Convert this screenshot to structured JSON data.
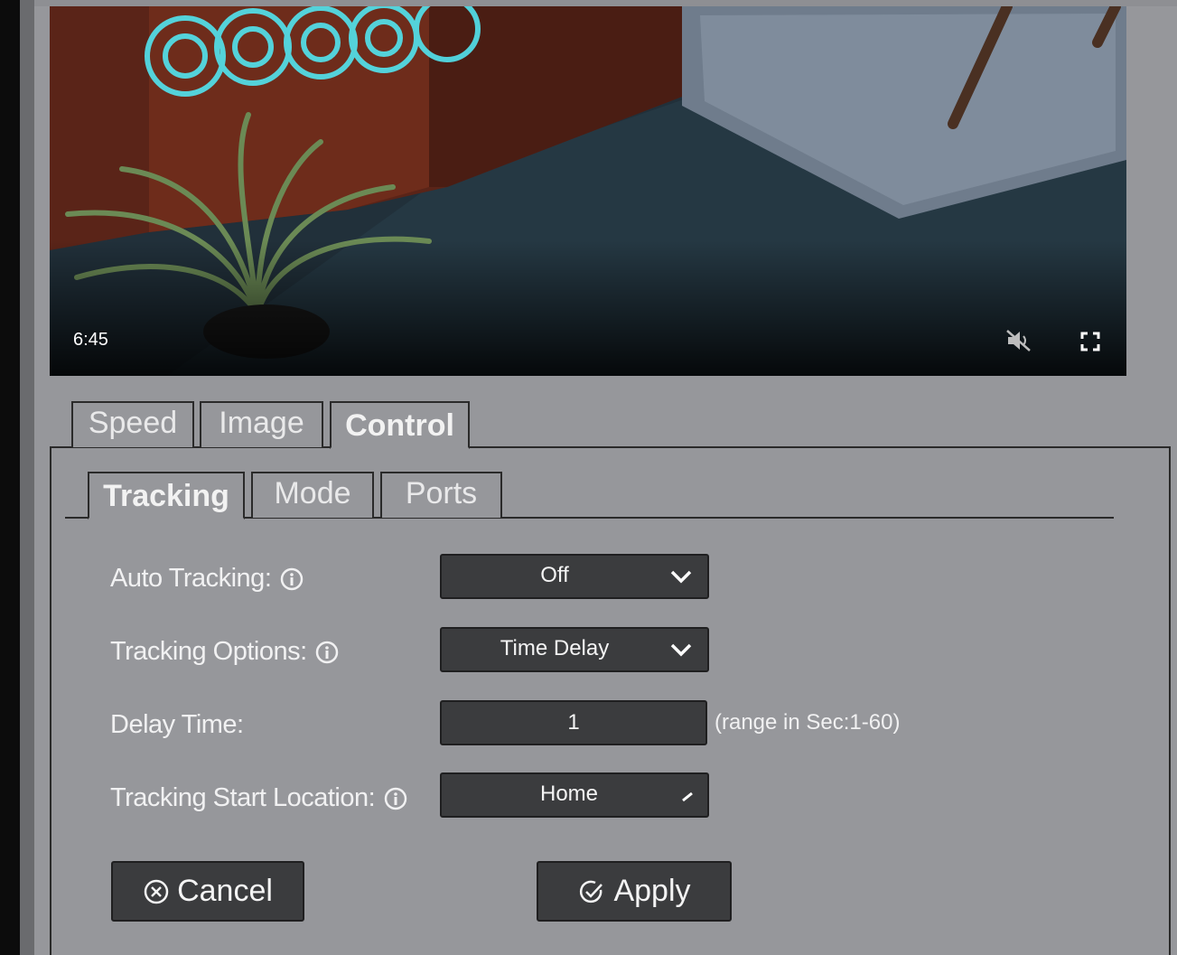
{
  "video": {
    "timestamp": "6:45",
    "mute_icon": "muted-speaker-icon",
    "fullscreen_icon": "fullscreen-icon"
  },
  "main_tabs": [
    {
      "label": "Speed",
      "active": false
    },
    {
      "label": "Image",
      "active": false
    },
    {
      "label": "Control",
      "active": true
    }
  ],
  "sub_tabs": [
    {
      "label": "Tracking",
      "active": true
    },
    {
      "label": "Mode",
      "active": false
    },
    {
      "label": "Ports",
      "active": false
    }
  ],
  "form": {
    "auto_tracking": {
      "label": "Auto Tracking:",
      "value": "Off"
    },
    "tracking_options": {
      "label": "Tracking Options:",
      "value": "Time Delay"
    },
    "delay_time": {
      "label": "Delay Time:",
      "value": "1",
      "range_note": "(range in Sec:1-60)"
    },
    "start_location": {
      "label": "Tracking Start Location:",
      "value": "Home"
    }
  },
  "buttons": {
    "cancel": "Cancel",
    "apply": "Apply"
  },
  "colors": {
    "background": "#96979b",
    "control_bg": "#3b3c3e",
    "text": "#f1f1f2"
  }
}
